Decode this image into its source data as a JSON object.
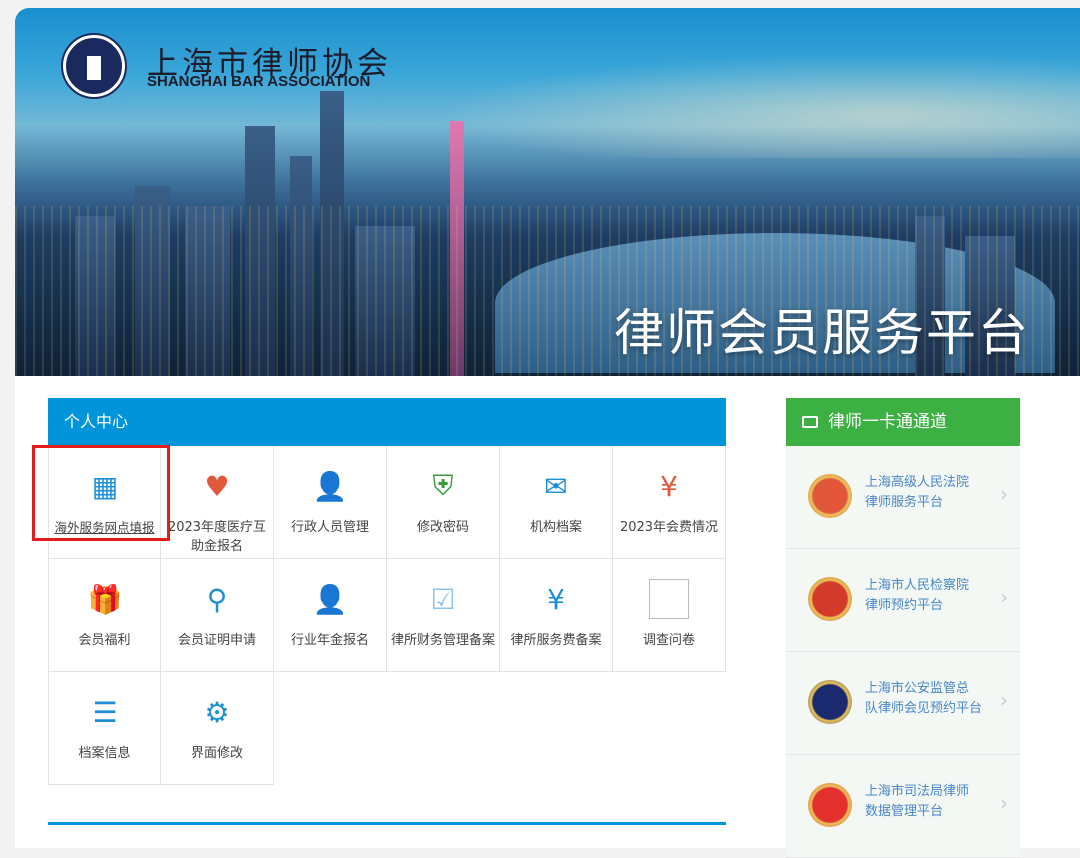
{
  "header": {
    "org_name_cn": "上海市律师协会",
    "org_name_en": "SHANGHAI BAR ASSOCIATION",
    "platform_title": "律师会员服务平台"
  },
  "personal_center": {
    "title": "个人中心",
    "items": [
      {
        "label": "海外服务网点填报",
        "icon": "layout-doc-icon",
        "highlighted": true
      },
      {
        "label": "2023年度医疗互助金报名",
        "icon": "heart-hands-icon"
      },
      {
        "label": "行政人员管理",
        "icon": "id-card-icon"
      },
      {
        "label": "修改密码",
        "icon": "shield-icon"
      },
      {
        "label": "机构档案",
        "icon": "envelope-icon"
      },
      {
        "label": "2023年会费情况",
        "icon": "yen-circle-icon"
      },
      {
        "label": "会员福利",
        "icon": "gift-icon"
      },
      {
        "label": "会员证明申请",
        "icon": "stamp-icon"
      },
      {
        "label": "行业年金报名",
        "icon": "id-card-icon"
      },
      {
        "label": "律所财务管理备案",
        "icon": "monitor-checklist-icon"
      },
      {
        "label": "律所服务费备案",
        "icon": "yen-doc-icon"
      },
      {
        "label": "调查问卷",
        "icon": "broken-image-icon"
      },
      {
        "label": "档案信息",
        "icon": "document-icon"
      },
      {
        "label": "界面修改",
        "icon": "gear-icon"
      }
    ]
  },
  "lawyer_channel": {
    "title": "律师一卡通通道",
    "items": [
      {
        "line1": "上海高级人民法院",
        "line2": "律师服务平台",
        "icon": "court-emblem-icon"
      },
      {
        "line1": "上海市人民检察院",
        "line2": "律师预约平台",
        "icon": "procuratorate-emblem-icon"
      },
      {
        "line1": "上海市公安监管总",
        "line2": "队律师会见预约平台",
        "icon": "police-emblem-icon"
      },
      {
        "line1": "上海市司法局律师",
        "line2": "数据管理平台",
        "icon": "justice-emblem-icon"
      }
    ]
  },
  "colors": {
    "blue": "#0095db",
    "green": "#3cb043",
    "highlight": "#e41c1c"
  }
}
